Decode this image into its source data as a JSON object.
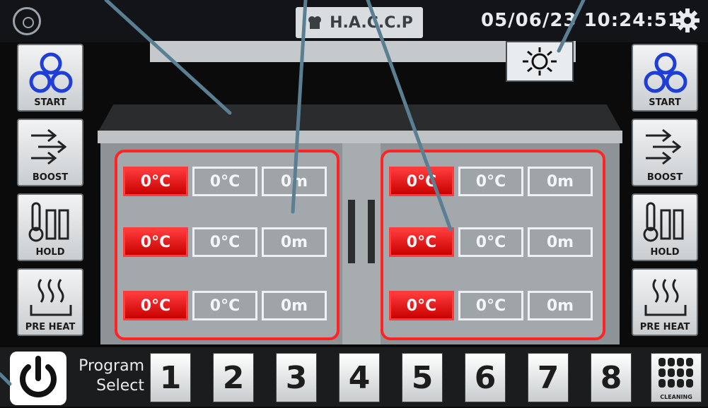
{
  "header": {
    "haccp_label": "H.A.C.C.P",
    "datetime": "05/06/23 10:24:51"
  },
  "left_buttons": [
    {
      "label": "START",
      "icon": "recycle-icon"
    },
    {
      "label": "BOOST",
      "icon": "arrows-icon"
    },
    {
      "label": "HOLD",
      "icon": "thermometer-icon"
    },
    {
      "label": "PRE HEAT",
      "icon": "heat-waves-icon"
    }
  ],
  "right_buttons": [
    {
      "label": "START",
      "icon": "recycle-icon"
    },
    {
      "label": "BOOST",
      "icon": "arrows-icon"
    },
    {
      "label": "HOLD",
      "icon": "thermometer-icon"
    },
    {
      "label": "PRE HEAT",
      "icon": "heat-waves-icon"
    }
  ],
  "left_panel": {
    "rows": [
      [
        "0°C",
        "0°C",
        "0m"
      ],
      [
        "0°C",
        "0°C",
        "0m"
      ],
      [
        "0°C",
        "0°C",
        "0m"
      ]
    ]
  },
  "right_panel": {
    "rows": [
      [
        "0°C",
        "0°C",
        "0m"
      ],
      [
        "0°C",
        "0°C",
        "0m"
      ],
      [
        "0°C",
        "0°C",
        "0m"
      ]
    ]
  },
  "footer": {
    "program_label_line1": "Program",
    "program_label_line2": "Select",
    "programs": [
      "1",
      "2",
      "3",
      "4",
      "5",
      "6",
      "7",
      "8"
    ],
    "cleaning_label": "CLEANING"
  },
  "colors": {
    "active_red": "#ff2424",
    "cell_gray": "#9fa4a8",
    "annotation": "#5b7f92",
    "icon_blue": "#1e3ed6"
  }
}
